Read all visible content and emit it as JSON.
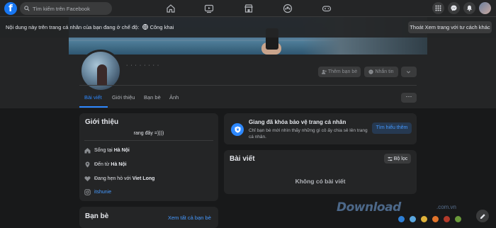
{
  "topbar": {
    "logo": "f",
    "search_placeholder": "Tìm kiếm trên Facebook",
    "nav_icons": [
      "home-icon",
      "watch-icon",
      "marketplace-icon",
      "groups-icon",
      "gaming-icon"
    ],
    "right_icons": [
      "menu-grid-icon",
      "messenger-icon",
      "bell-icon"
    ]
  },
  "notice": {
    "text": "Nội dung này trên trang cá nhân của bạn đang ở chế độ:",
    "mode": "Công khai",
    "exit_button": "Thoát Xem trang với tư cách khác"
  },
  "profile": {
    "name": "· · · · ·  · · ·",
    "add_friend": "Thêm bạn bè",
    "message": "Nhắn tin"
  },
  "tabs": [
    "Bài viết",
    "Giới thiệu",
    "Bạn bè",
    "Ảnh"
  ],
  "intro": {
    "title": "Giới thiệu",
    "bio": "rang đây =))))",
    "lives_label": "Sống tại",
    "lives_value": "Hà Nội",
    "from_label": "Đến từ",
    "from_value": "Hà Nội",
    "relationship_label": "Đang hẹn hò với",
    "relationship_value": "Viet Long",
    "instagram": "itshunie"
  },
  "friends": {
    "title": "Bạn bè",
    "see_all": "Xem tất cả bạn bè"
  },
  "lock_card": {
    "title": "Giang đã khóa bảo vệ trang cá nhân",
    "description": "Chỉ bạn bè mới nhìn thấy những gì cô ấy chia sẻ lên trang cá nhân.",
    "learn_more": "Tìm hiểu thêm"
  },
  "posts": {
    "title": "Bài viết",
    "filter": "Bộ lọc",
    "empty": "Không có bài viết"
  },
  "watermark": {
    "brand": "Download",
    "domain": ".com.vn",
    "dot_colors": [
      "#2d7fd6",
      "#5aa6de",
      "#e0b23a",
      "#e2742b",
      "#b33a2a",
      "#6a9a3a"
    ]
  },
  "colors": {
    "accent": "#2d88ff",
    "background": "#18191a",
    "surface": "#242526"
  }
}
